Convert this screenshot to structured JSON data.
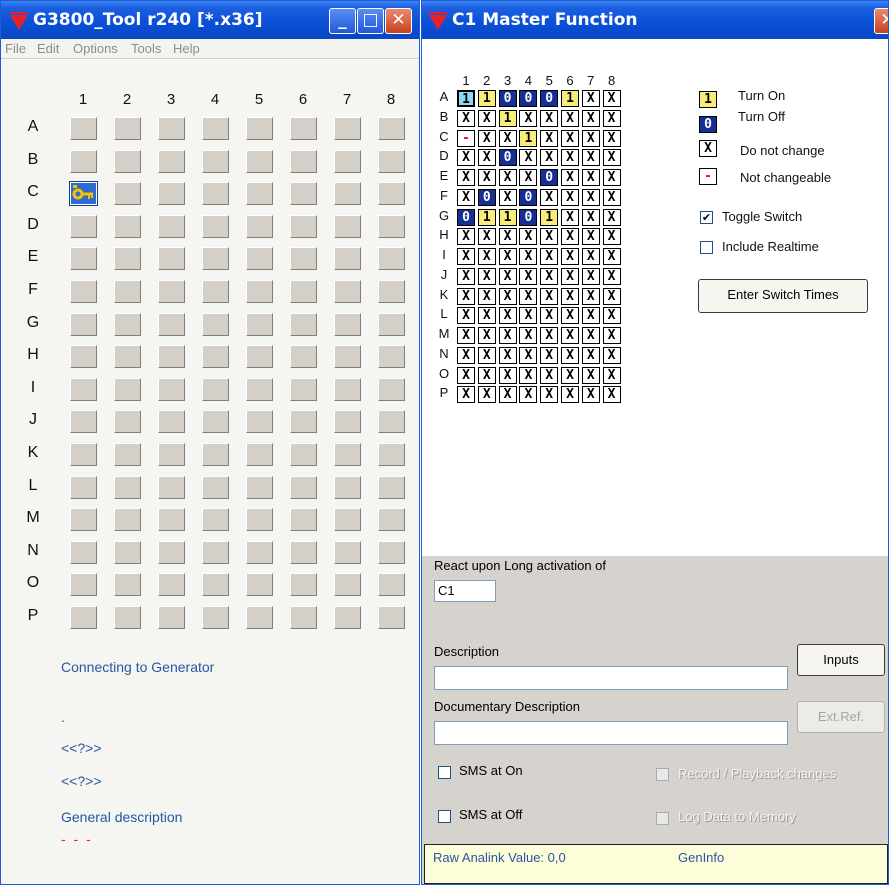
{
  "tool_window": {
    "title": "G3800_Tool r240 [*.x36]",
    "buttons": {
      "minimize": "_",
      "maximize": "□",
      "close": "✕"
    },
    "menu": [
      "File",
      "Edit",
      "Options",
      "Tools",
      "Help"
    ],
    "columns": [
      "1",
      "2",
      "3",
      "4",
      "5",
      "6",
      "7",
      "8"
    ],
    "rows": [
      "A",
      "B",
      "C",
      "D",
      "E",
      "F",
      "G",
      "H",
      "I",
      "J",
      "K",
      "L",
      "M",
      "N",
      "O",
      "P"
    ],
    "key_cell": {
      "row": "C",
      "col": "1",
      "icon": "key-icon"
    },
    "status_lines": [
      "Connecting to Generator",
      ".",
      "<<?>>",
      "<<?>>",
      "General description",
      "- - -"
    ]
  },
  "master_window": {
    "title": "C1   Master Function",
    "buttons": {
      "close": "✕"
    },
    "columns": [
      "1",
      "2",
      "3",
      "4",
      "5",
      "6",
      "7",
      "8"
    ],
    "rows": [
      "A",
      "B",
      "C",
      "D",
      "E",
      "F",
      "G",
      "H",
      "I",
      "J",
      "K",
      "L",
      "M",
      "N",
      "O",
      "P"
    ],
    "grid": [
      [
        "sel",
        "on",
        "off",
        "off",
        "off",
        "on",
        "x",
        "x"
      ],
      [
        "x",
        "x",
        "on",
        "x",
        "x",
        "x",
        "x",
        "x"
      ],
      [
        "nc",
        "x",
        "x",
        "on",
        "x",
        "x",
        "x",
        "x"
      ],
      [
        "x",
        "x",
        "off",
        "x",
        "x",
        "x",
        "x",
        "x"
      ],
      [
        "x",
        "x",
        "x",
        "x",
        "off",
        "x",
        "x",
        "x"
      ],
      [
        "x",
        "off",
        "x",
        "off",
        "x",
        "x",
        "x",
        "x"
      ],
      [
        "off",
        "on",
        "on",
        "off",
        "on",
        "x",
        "x",
        "x"
      ],
      [
        "x",
        "x",
        "x",
        "x",
        "x",
        "x",
        "x",
        "x"
      ],
      [
        "x",
        "x",
        "x",
        "x",
        "x",
        "x",
        "x",
        "x"
      ],
      [
        "x",
        "x",
        "x",
        "x",
        "x",
        "x",
        "x",
        "x"
      ],
      [
        "x",
        "x",
        "x",
        "x",
        "x",
        "x",
        "x",
        "x"
      ],
      [
        "x",
        "x",
        "x",
        "x",
        "x",
        "x",
        "x",
        "x"
      ],
      [
        "x",
        "x",
        "x",
        "x",
        "x",
        "x",
        "x",
        "x"
      ],
      [
        "x",
        "x",
        "x",
        "x",
        "x",
        "x",
        "x",
        "x"
      ],
      [
        "x",
        "x",
        "x",
        "x",
        "x",
        "x",
        "x",
        "x"
      ],
      [
        "x",
        "x",
        "x",
        "x",
        "x",
        "x",
        "x",
        "x"
      ]
    ],
    "symbols": {
      "on": "1",
      "off": "0",
      "x": "X",
      "nc": "-",
      "sel": "1"
    },
    "legend": [
      {
        "state": "on",
        "label": "Turn On"
      },
      {
        "state": "off",
        "label": "Turn Off"
      },
      {
        "state": "x",
        "label": "Do not change"
      },
      {
        "state": "nc",
        "label": "Not changeable"
      }
    ],
    "toggle_switch": {
      "label": "Toggle Switch",
      "checked": true
    },
    "include_realtime": {
      "label": "Include Realtime",
      "checked": false
    },
    "enter_switch_times": "Enter Switch Times",
    "react_label": "React upon Long activation of",
    "react_value": "C1",
    "description_label": "Description",
    "description_value": "",
    "doc_description_label": "Documentary Description",
    "doc_description_value": "",
    "inputs_button": "Inputs",
    "extref_button": "Ext.Ref.",
    "sms_on": "SMS at On",
    "sms_off": "SMS at Off",
    "record_playback": "Record / Playback changes",
    "log_data": "Log Data to Memory",
    "raw_analink": "Raw Analink Value: 0,0",
    "geninfo": "GenInfo"
  },
  "colors": {
    "titlebar": "#0a50d8",
    "on": "#f8ec7b",
    "off": "#162f95",
    "selected": "#8bd8f0",
    "link": "#2856a4"
  }
}
